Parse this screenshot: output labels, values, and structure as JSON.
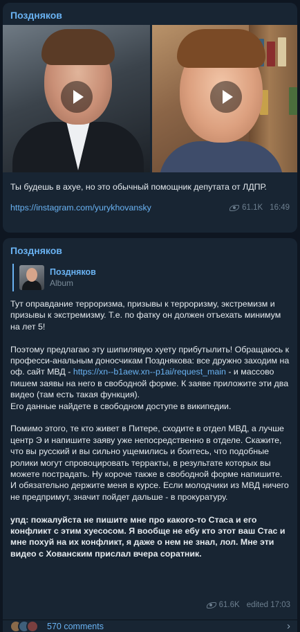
{
  "post1": {
    "sender": "Поздняков",
    "text": "Ты будешь в ахуе, но это обычный помощник депутата от ЛДПР.",
    "link": "https://instagram.com/yurykhovansky",
    "views": "61.1K",
    "time": "16:49"
  },
  "post2": {
    "sender": "Поздняков",
    "reply": {
      "name": "Поздняков",
      "type": "Album"
    },
    "paragraphs": [
      "Тут оправдание терроризма, призывы к терроризму, экстремизм и призывы к экстремизму. Т.е. по фатку он должен отъехать минимум на лет 5!",
      {
        "before": "Поэтому предлагаю эту шипилявую хуету прибутылить! Обращаюсь к професси-анальным доносчикам Позднякова: все дружно заходим на оф. сайт МВД - ",
        "link": "https://xn--b1aew.xn--p1ai/request_main",
        "after": " - и массово пишем заявы на него в свободной форме. К заяве приложите эти два видео (там есть такая функция).\nЕго данные найдете в свободном доступе в википедии."
      },
      "Помимо этого, те кто живет в Питере, сходите в отдел МВД, а лучше центр Э и напишите заяву уже непосредственно в отделе. Скажите, что вы русский и вы сильно ущемились и боитесь, что подобные ролики могут спровоцировать терракты, в результате которых вы можете пострадать. Ну короче также в свободной форме напишите.\nИ обязательно держите меня в курсе. Если молодчики из МВД ничего не предпримут, значит пойдет дальше - в прокуратуру.",
      "упд: пожалуйста не пишите мне про какого-то Стаса и его конфликт с этим хуесосом. Я вообще не ебу кто этот ваш Стас и мне похуй на их конфликт, я даже о нем не знал, лол. Мне эти видео с Хованским прислал вчера соратник."
    ],
    "views": "61.6K",
    "edited_time": "edited 17:03"
  },
  "comments": {
    "label": "570 comments",
    "avatar_colors": [
      "#8a6a4a",
      "#3f5f7a",
      "#7a3f3f"
    ]
  },
  "icons": {
    "views": "eye-icon",
    "play": "play-icon",
    "chevron": "chevron-right-icon"
  },
  "colors": {
    "background": "#0e1621",
    "bubble": "#182533",
    "accent": "#6ab3f3",
    "meta": "#6d7f8f"
  }
}
